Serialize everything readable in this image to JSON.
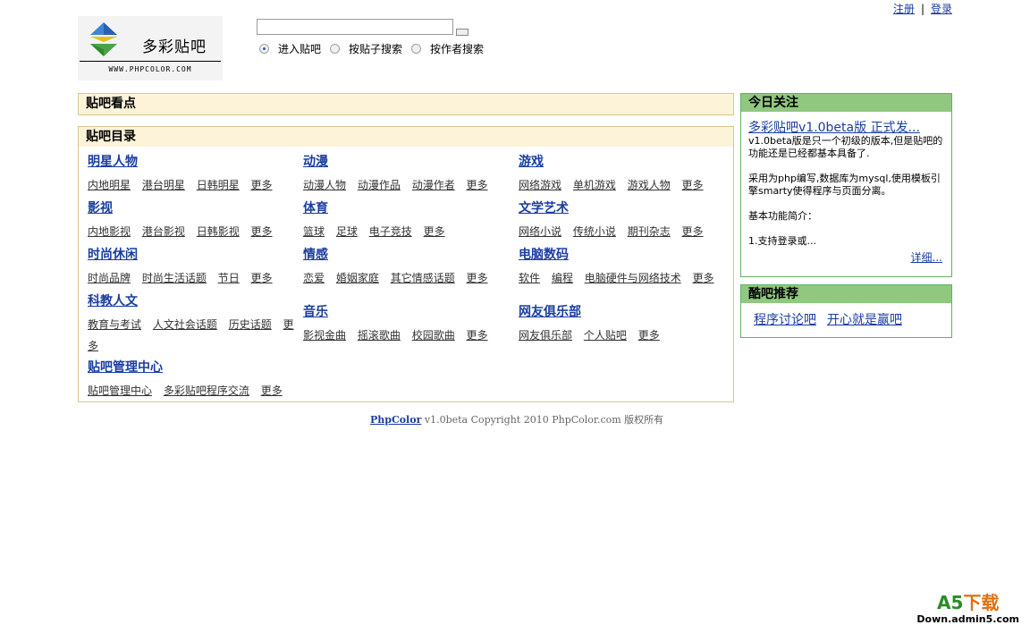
{
  "top_links": {
    "register": "注册",
    "separator": "|",
    "login": "登录"
  },
  "logo": {
    "name": "多彩贴吧",
    "url_text": "WWW.PHPCOLOR.COM"
  },
  "search": {
    "value": "",
    "radios": [
      {
        "label": "进入贴吧",
        "selected": true
      },
      {
        "label": "按贴子搜索",
        "selected": false
      },
      {
        "label": "按作者搜索",
        "selected": false
      }
    ]
  },
  "hot": {
    "title": "贴吧看点"
  },
  "directory": {
    "title": "贴吧目录",
    "categories": [
      {
        "title": "明星人物",
        "links": [
          "内地明星",
          "港台明星",
          "日韩明星",
          "更多"
        ]
      },
      {
        "title": "动漫",
        "links": [
          "动漫人物",
          "动漫作品",
          "动漫作者",
          "更多"
        ]
      },
      {
        "title": "游戏",
        "links": [
          "网络游戏",
          "单机游戏",
          "游戏人物",
          "更多"
        ]
      },
      {
        "title": "影视",
        "links": [
          "内地影视",
          "港台影视",
          "日韩影视",
          "更多"
        ]
      },
      {
        "title": "体育",
        "links": [
          "篮球",
          "足球",
          "电子竞技",
          "更多"
        ]
      },
      {
        "title": "文学艺术",
        "links": [
          "网络小说",
          "传统小说",
          "期刊杂志",
          "更多"
        ]
      },
      {
        "title": "时尚休闲",
        "links": [
          "时尚品牌",
          "时尚生活话题",
          "节日",
          "更多"
        ]
      },
      {
        "title": "情感",
        "links": [
          "恋爱",
          "婚姻家庭",
          "其它情感话题",
          "更多"
        ]
      },
      {
        "title": "电脑数码",
        "links": [
          "软件",
          "编程",
          "电脑硬件与网络技术",
          "更多"
        ]
      },
      {
        "title": "科教人文",
        "links": [
          "教育与考试",
          "人文社会话题",
          "历史话题",
          "更多"
        ]
      },
      {
        "title": "音乐",
        "links": [
          "影视金曲",
          "摇滚歌曲",
          "校园歌曲",
          "更多"
        ]
      },
      {
        "title": "网友俱乐部",
        "links": [
          "网友俱乐部",
          "个人贴吧",
          "更多"
        ]
      },
      {
        "title": "贴吧管理中心",
        "links": [
          "贴吧管理中心",
          "多彩贴吧程序交流",
          "更多"
        ]
      }
    ]
  },
  "today": {
    "title": "今日关注",
    "headline": "多彩贴吧v1.0beta版 正式发...",
    "paragraphs": [
      "v1.0beta版是只一个初级的版本,但是贴吧的功能还是已经都基本具备了.",
      "采用为php编写,数据库为mysql,使用模板引擎smarty使得程序与页面分离。",
      "基本功能简介：",
      "1.支持登录或..."
    ],
    "more": "详细..."
  },
  "recommend": {
    "title": "酷吧推荐",
    "items": [
      "程序讨论吧",
      "开心就是赢吧"
    ]
  },
  "footer": {
    "link": "PhpColor",
    "text": " v1.0beta Copyright 2010 PhpColor.com 版权所有"
  },
  "watermark": {
    "brand_a": "A5",
    "brand_b": "下载",
    "domain": "Down.admin5.com"
  },
  "colors": {
    "link_blue": "#1a3ea0",
    "box_border": "#dac58b",
    "box_bg": "#fcf3d9",
    "green_border": "#64b064",
    "green_header": "#90c880"
  },
  "icons": {
    "logo": "diamond-logo-icon",
    "search_button": "search-button-icon"
  }
}
